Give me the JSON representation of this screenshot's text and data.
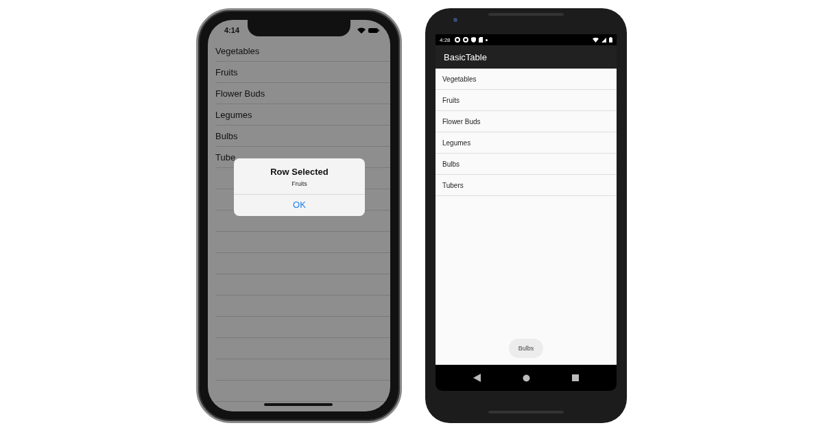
{
  "ios": {
    "status_bar": {
      "time": "4:14"
    },
    "list": [
      {
        "label": "Vegetables"
      },
      {
        "label": "Fruits"
      },
      {
        "label": "Flower Buds"
      },
      {
        "label": "Legumes"
      },
      {
        "label": "Bulbs"
      },
      {
        "label": "Tube"
      }
    ],
    "alert": {
      "title": "Row Selected",
      "message": "Fruits",
      "button": "OK"
    }
  },
  "android": {
    "status_bar": {
      "time": "4:28"
    },
    "app_bar": {
      "title": "BasicTable"
    },
    "list": [
      {
        "label": "Vegetables"
      },
      {
        "label": "Fruits"
      },
      {
        "label": "Flower Buds"
      },
      {
        "label": "Legumes"
      },
      {
        "label": "Bulbs"
      },
      {
        "label": "Tubers"
      }
    ],
    "toast": "Bulbs"
  }
}
